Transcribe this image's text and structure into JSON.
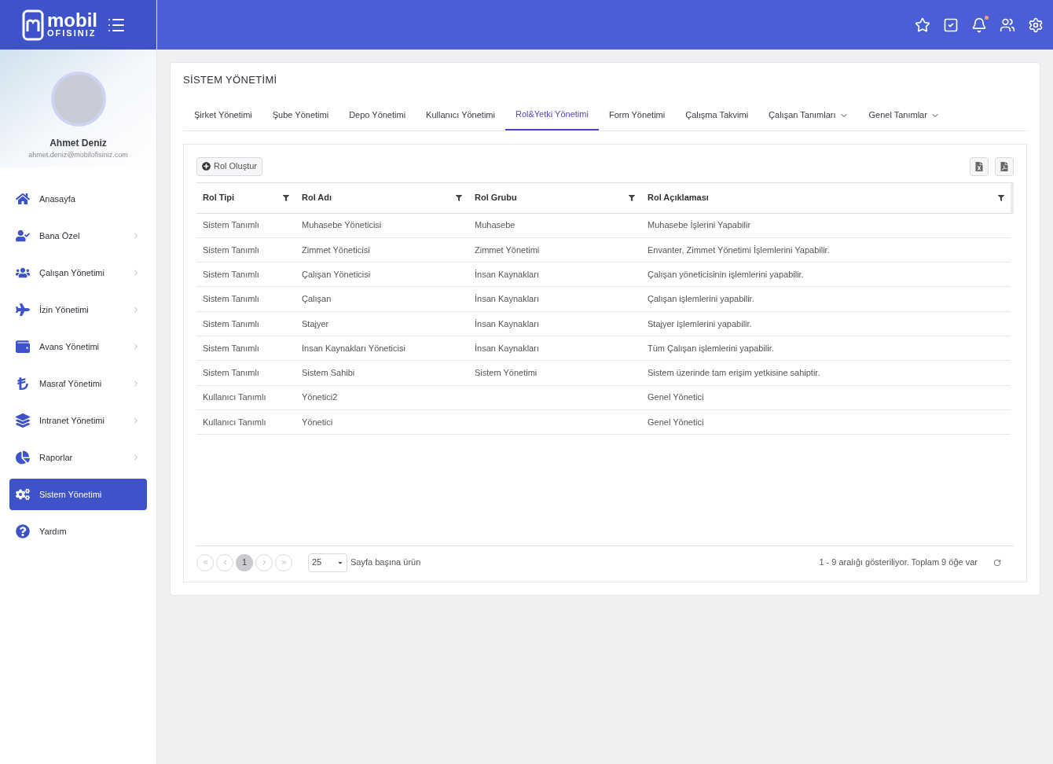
{
  "logo": {
    "word": "mobil",
    "subword": "OFISINIZ"
  },
  "header": {
    "notification_dot": true
  },
  "profile": {
    "name": "Ahmet Deniz",
    "email": "ahmet.deniz@mobilofisiniz.com"
  },
  "sidebar": {
    "items": [
      {
        "label": "Anasayfa",
        "has_submenu": false,
        "selected": false
      },
      {
        "label": "Bana Özel",
        "has_submenu": true,
        "selected": false
      },
      {
        "label": "Çalışan Yönetimi",
        "has_submenu": true,
        "selected": false
      },
      {
        "label": "İzin Yönetimi",
        "has_submenu": true,
        "selected": false
      },
      {
        "label": "Avans Yönetimi",
        "has_submenu": true,
        "selected": false
      },
      {
        "label": "Masraf Yönetimi",
        "has_submenu": true,
        "selected": false
      },
      {
        "label": "Intranet Yönetimi",
        "has_submenu": true,
        "selected": false
      },
      {
        "label": "Raporlar",
        "has_submenu": true,
        "selected": false
      },
      {
        "label": "Sistem Yönetimi",
        "has_submenu": false,
        "selected": true
      },
      {
        "label": "Yardım",
        "has_submenu": false,
        "selected": false
      }
    ]
  },
  "page_title": "SİSTEM YÖNETİMİ",
  "tabs": [
    {
      "label": "Şirket Yönetimi",
      "dropdown": false,
      "selected": false
    },
    {
      "label": "Şube Yönetimi",
      "dropdown": false,
      "selected": false
    },
    {
      "label": "Depo Yönetimi",
      "dropdown": false,
      "selected": false
    },
    {
      "label": "Kullanıcı Yönetimi",
      "dropdown": false,
      "selected": false
    },
    {
      "label": "Rol&Yetki Yönetimi",
      "dropdown": false,
      "selected": true
    },
    {
      "label": "Form Yönetimi",
      "dropdown": false,
      "selected": false
    },
    {
      "label": "Çalışma Takvimi",
      "dropdown": false,
      "selected": false
    },
    {
      "label": "Çalışan Tanımları",
      "dropdown": true,
      "selected": false
    },
    {
      "label": "Genel Tanımlar",
      "dropdown": true,
      "selected": false
    }
  ],
  "create_button": "Rol Oluştur",
  "table": {
    "columns": [
      "Rol Tipi",
      "Rol Adı",
      "Rol Grubu",
      "Rol Açıklaması"
    ],
    "rows": [
      [
        "Sistem Tanımlı",
        "Muhasebe Yöneticisi",
        "Muhasebe",
        "Muhasebe İşlerini Yapabilir"
      ],
      [
        "Sistem Tanımlı",
        "Zimmet Yöneticisi",
        "Zimmet Yönetimi",
        "Envanter, Zimmet Yönetimi İşlemlerini Yapabilir."
      ],
      [
        "Sistem Tanımlı",
        "Çalışan Yöneticisi",
        "İnsan Kaynakları",
        "Çalışan yöneticisinin işlemlerini yapabilir."
      ],
      [
        "Sistem Tanımlı",
        "Çalışan",
        "İnsan Kaynakları",
        "Çalışan işlemlerini yapabilir."
      ],
      [
        "Sistem Tanımlı",
        "Stajyer",
        "İnsan Kaynakları",
        "Stajyer işlemlerini yapabilir."
      ],
      [
        "Sistem Tanımlı",
        "Insan Kaynakları Yöneticisi",
        "İnsan Kaynakları",
        "Tüm Çalışan işlemlerini yapabilir."
      ],
      [
        "Sistem Tanımlı",
        "Sistem Sahibi",
        "Sistem Yönetimi",
        "Sistem üzerinde tam erişim yetkisine sahiptir."
      ],
      [
        "Kullanıcı Tanımlı",
        "Yönetici2",
        "",
        "Genel Yönetici"
      ],
      [
        "Kullanıcı Tanımlı",
        "Yönetici",
        "",
        "Genel Yönetici"
      ]
    ]
  },
  "pager": {
    "pages": [
      {
        "label": "1",
        "selected": true
      }
    ],
    "page_size": "25",
    "page_size_label": "Sayfa başına ürün",
    "summary": "1 - 9 aralığı gösteriliyor. Toplam 9 öğe var"
  }
}
